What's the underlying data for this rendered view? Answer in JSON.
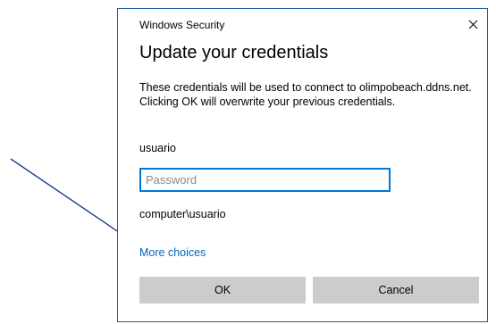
{
  "dialog": {
    "app_label": "Windows Security",
    "title": "Update your credentials",
    "description": "These credentials will be used to connect to olimpobeach.ddns.net. Clicking OK will overwrite your previous credentials.",
    "username": "usuario",
    "password_placeholder": "Password",
    "domain_user": "computer\\usuario",
    "more_choices": "More choices",
    "ok_label": "OK",
    "cancel_label": "Cancel"
  },
  "colors": {
    "accent": "#0078d7",
    "link": "#0067c0",
    "button_bg": "#cccccc",
    "annotation_arrow": "#1f3f8f"
  },
  "icons": {
    "close": "close-icon",
    "annotation": "annotation-arrow"
  }
}
